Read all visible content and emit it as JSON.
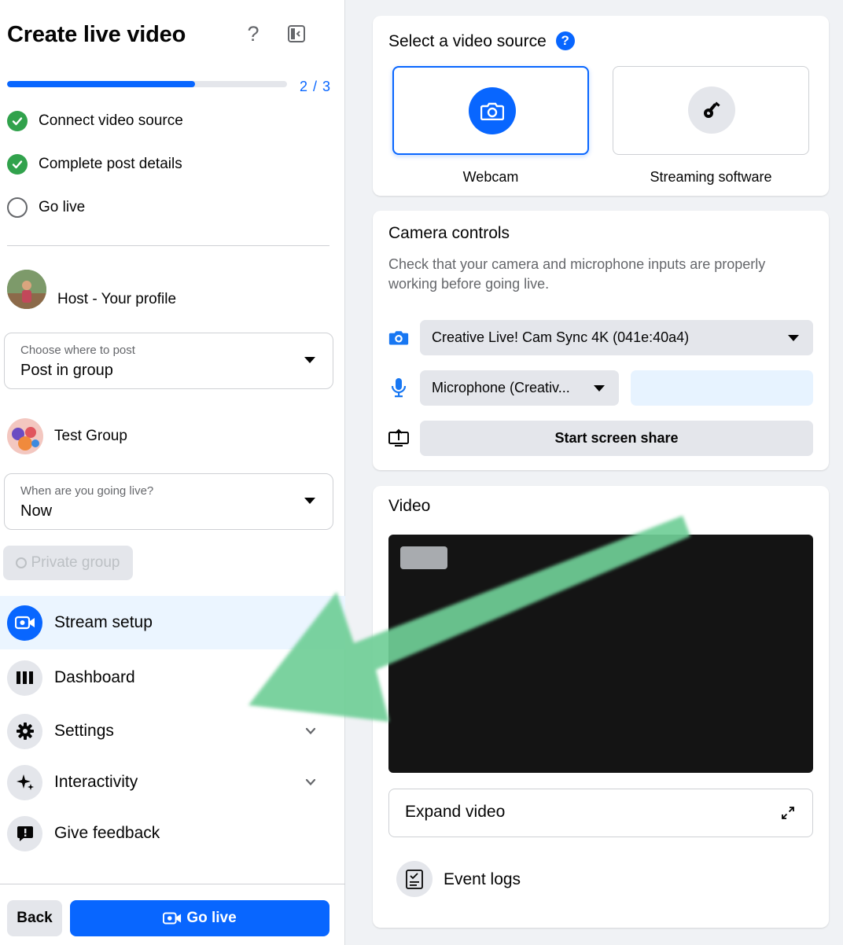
{
  "header": {
    "title": "Create live video"
  },
  "progress": {
    "label": "2 / 3",
    "fraction": 0.67
  },
  "steps": [
    {
      "label": "Connect video source",
      "done": true
    },
    {
      "label": "Complete post details",
      "done": true
    },
    {
      "label": "Go live",
      "done": false
    }
  ],
  "host": {
    "label": "Host - Your profile"
  },
  "post_target": {
    "caption": "Choose where to post",
    "value": "Post in group"
  },
  "group": {
    "name": "Test Group"
  },
  "timing": {
    "caption": "When are you going live?",
    "value": "Now"
  },
  "privacy": {
    "label": "Private group"
  },
  "nav": {
    "stream_setup": "Stream setup",
    "dashboard": "Dashboard",
    "settings": "Settings",
    "interactivity": "Interactivity",
    "feedback": "Give feedback"
  },
  "footer": {
    "back": "Back",
    "go_live": "Go live"
  },
  "video_source": {
    "title": "Select a video source",
    "webcam": "Webcam",
    "streaming": "Streaming software"
  },
  "camera_controls": {
    "title": "Camera controls",
    "description": "Check that your camera and microphone inputs are properly working before going live.",
    "camera_value": "Creative Live! Cam Sync 4K (041e:40a4)",
    "mic_value": "Microphone (Creativ...",
    "share_label": "Start screen share"
  },
  "video": {
    "title": "Video",
    "expand_label": "Expand video",
    "logs_label": "Event logs"
  },
  "colors": {
    "accent": "#0866ff",
    "success": "#31a24c",
    "arrow": "#6fcf97"
  }
}
